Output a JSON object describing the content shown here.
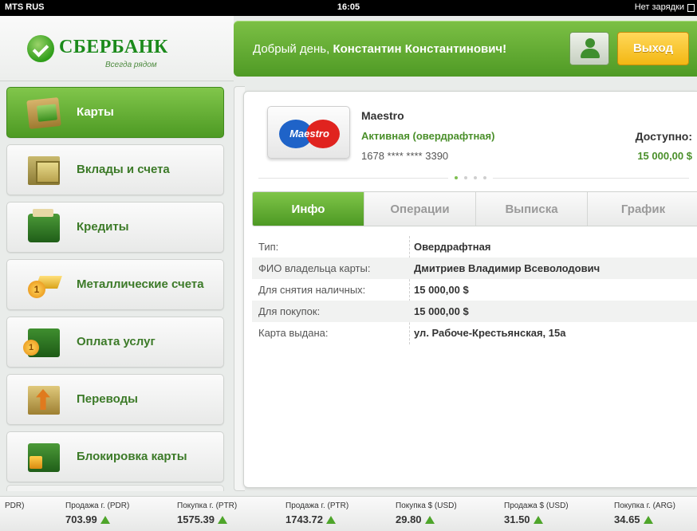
{
  "statusbar": {
    "carrier": "MTS RUS",
    "time": "16:05",
    "charge": "Нет зарядки"
  },
  "header": {
    "brand": "СБЕРБАНК",
    "slogan": "Всегда рядом",
    "greeting_prefix": "Добрый день,",
    "user_name": "Константин Константинович!",
    "exit_label": "Выход"
  },
  "colors": {
    "accent": "#5aa82f",
    "accent_text": "#4a8f2a",
    "exit": "#f3b713"
  },
  "sidebar": {
    "items": [
      {
        "label": "Карты",
        "icon": "card-icon",
        "active": true
      },
      {
        "label": "Вклады и счета",
        "icon": "money-icon",
        "active": false
      },
      {
        "label": "Кредиты",
        "icon": "wallet-icon",
        "active": false
      },
      {
        "label": "Металлические счета",
        "icon": "gold-bar-icon",
        "active": false
      },
      {
        "label": "Оплата услуг",
        "icon": "briefcase-icon",
        "active": false
      },
      {
        "label": "Переводы",
        "icon": "transfer-icon",
        "active": false
      },
      {
        "label": "Блокировка карты",
        "icon": "lock-icon",
        "active": false
      }
    ]
  },
  "card": {
    "logo_text": "Maestro",
    "name": "Maestro",
    "status": "Активная (овердрафтная)",
    "number": "1678 **** **** 3390",
    "available_label": "Доступно:",
    "available_value": "15 000,00 $",
    "pager": {
      "pages": 4,
      "current": 1
    }
  },
  "tabs": [
    {
      "label": "Инфо",
      "active": true
    },
    {
      "label": "Операции",
      "active": false
    },
    {
      "label": "Выписка",
      "active": false
    },
    {
      "label": "График",
      "active": false
    }
  ],
  "info": [
    {
      "key": "Тип:",
      "value": "Овердрафтная"
    },
    {
      "key": "ФИО владельца карты:",
      "value": "Дмитриев Владимир Всеволодович"
    },
    {
      "key": "Для снятия наличных:",
      "value": "15 000,00 $"
    },
    {
      "key": "Для покупок:",
      "value": "15 000,00 $"
    },
    {
      "key": "Карта выдана:",
      "value": "ул. Рабоче-Крестьянская, 15а"
    }
  ],
  "ticker": [
    {
      "label": "PDR)",
      "value": ""
    },
    {
      "label": "Продажа г. (PDR)",
      "value": "703.99"
    },
    {
      "label": "Покупка г. (PTR)",
      "value": "1575.39"
    },
    {
      "label": "Продажа г. (PTR)",
      "value": "1743.72"
    },
    {
      "label": "Покупка $ (USD)",
      "value": "29.80"
    },
    {
      "label": "Продажа $ (USD)",
      "value": "31.50"
    },
    {
      "label": "Покупка г. (ARG)",
      "value": "34.65"
    }
  ]
}
